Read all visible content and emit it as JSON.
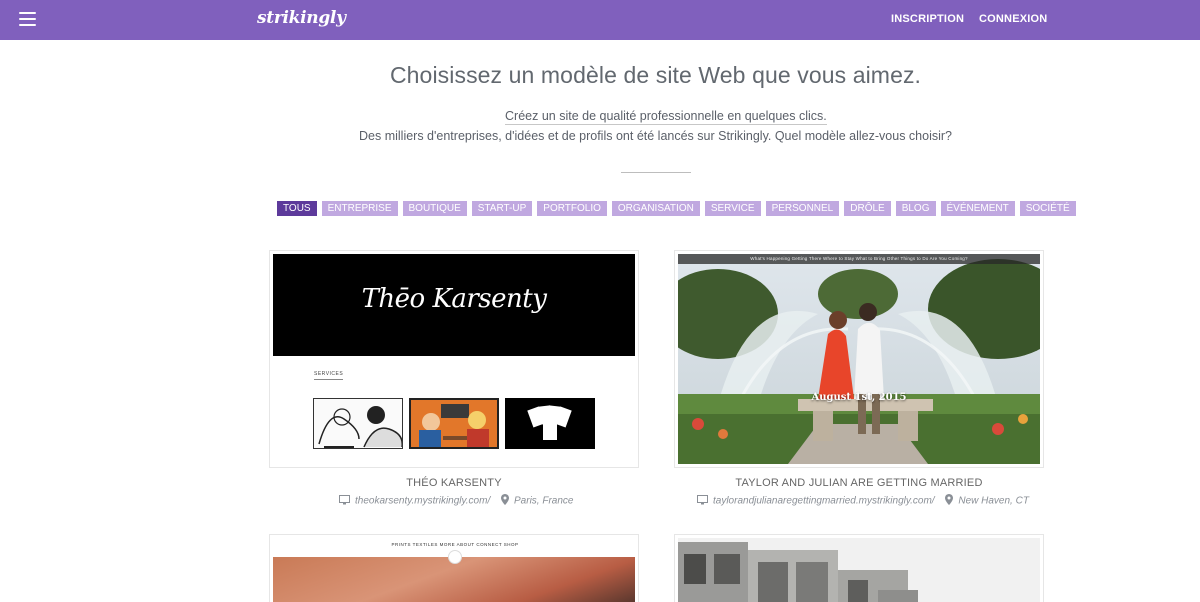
{
  "header": {
    "logo": "strikingly",
    "signup_label": "INSCRIPTION",
    "login_label": "CONNEXION"
  },
  "hero": {
    "title": "Choisissez un modèle de site Web que vous aimez.",
    "link_text": "Créez un site de qualité professionnelle en quelques clics.",
    "subtitle": "Des milliers d'entreprises, d'idées et de profils ont été lancés sur Strikingly. Quel modèle allez-vous choisir?"
  },
  "filters": [
    {
      "label": "TOUS",
      "active": true
    },
    {
      "label": "ENTREPRISE",
      "active": false
    },
    {
      "label": "BOUTIQUE",
      "active": false
    },
    {
      "label": "START-UP",
      "active": false
    },
    {
      "label": "PORTFOLIO",
      "active": false
    },
    {
      "label": "ORGANISATION",
      "active": false
    },
    {
      "label": "SERVICE",
      "active": false
    },
    {
      "label": "PERSONNEL",
      "active": false
    },
    {
      "label": "DRÔLE",
      "active": false
    },
    {
      "label": "BLOG",
      "active": false
    },
    {
      "label": "ÉVÉNEMENT",
      "active": false
    },
    {
      "label": "SOCIÉTÉ",
      "active": false
    }
  ],
  "templates": [
    {
      "title": "THÉO KARSENTY",
      "url": "theokarsenty.mystrikingly.com/",
      "location": "Paris, France",
      "preview_name": "Thēo Karsenty",
      "preview_section": "SERVICES"
    },
    {
      "title": "TAYLOR AND JULIAN ARE GETTING MARRIED",
      "url": "taylorandjulianaregettingmarried.mystrikingly.com/",
      "location": "New Haven, CT",
      "preview_nav": "What's Happening   Getting There   Where to Stay   What to Bring   Other Things to Do   Are You Coming?",
      "preview_date": "August 1st, 2015"
    },
    {
      "preview_nav": "PRINTS     TEXTILES     MORE     ABOUT     CONNECT     SHOP"
    },
    {}
  ],
  "colors": {
    "header_bg": "#8060bd",
    "chip_bg": "#c0a8e0",
    "chip_active_bg": "#5d3a9b"
  }
}
